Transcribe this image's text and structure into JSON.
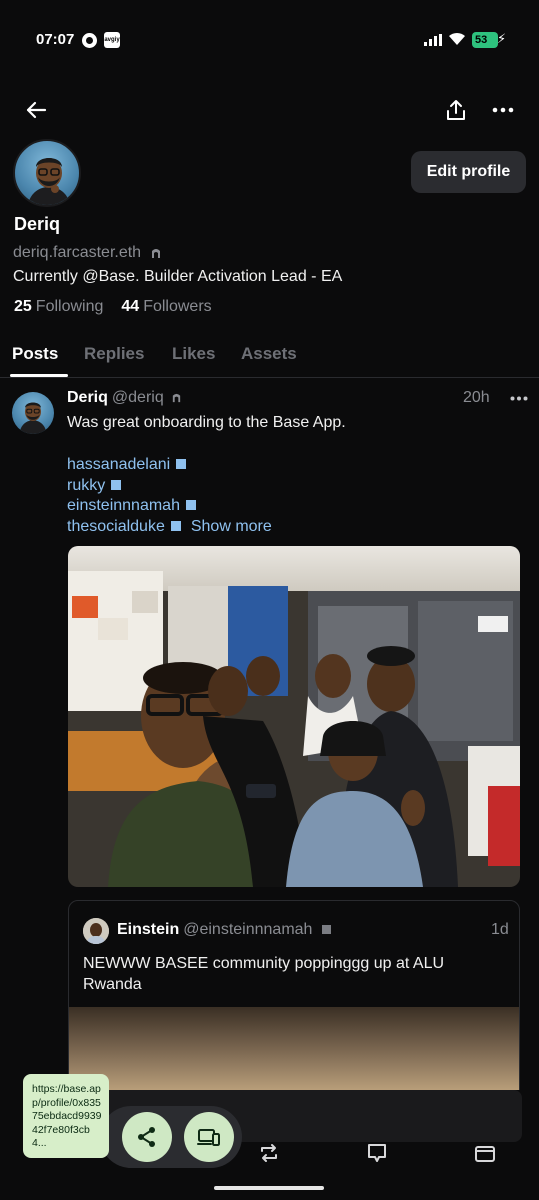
{
  "status": {
    "time": "07:07",
    "app_badge": "avgiy",
    "battery": "53"
  },
  "nav": {
    "back_icon": "arrow-left-icon",
    "share_icon": "share-upload-icon",
    "more_icon": "more-horizontal-icon"
  },
  "profile": {
    "name": "Deriq",
    "handle": "deriq.farcaster.eth",
    "bio": "Currently @Base. Builder Activation Lead - EA",
    "following_count": "25",
    "following_label": "Following",
    "followers_count": "44",
    "followers_label": "Followers",
    "edit_label": "Edit profile"
  },
  "tabs": [
    {
      "label": "Posts",
      "active": true
    },
    {
      "label": "Replies",
      "active": false
    },
    {
      "label": "Likes",
      "active": false
    },
    {
      "label": "Assets",
      "active": false
    }
  ],
  "post": {
    "author": "Deriq",
    "handle": "@deriq",
    "time": "20h",
    "text": "Was great onboarding to the Base App.",
    "mentions": [
      "hassanadelani",
      "rukky",
      "einsteinnnamah",
      "thesocialduke"
    ],
    "show_more": "Show more"
  },
  "quote": {
    "author": "Einstein",
    "handle": "@einsteinnnamah",
    "time": "1d",
    "text": "NEWWW BASEE community poppinggg up at ALU Rwanda"
  },
  "overlay": {
    "url": "https://base.app/profile/0x83575ebdacd993942f7e80f3cb4..."
  },
  "colors": {
    "background": "#0b0b0c",
    "link": "#8fc1ef",
    "muted": "#8a8c92",
    "pill_button": "#cfe8c4"
  }
}
